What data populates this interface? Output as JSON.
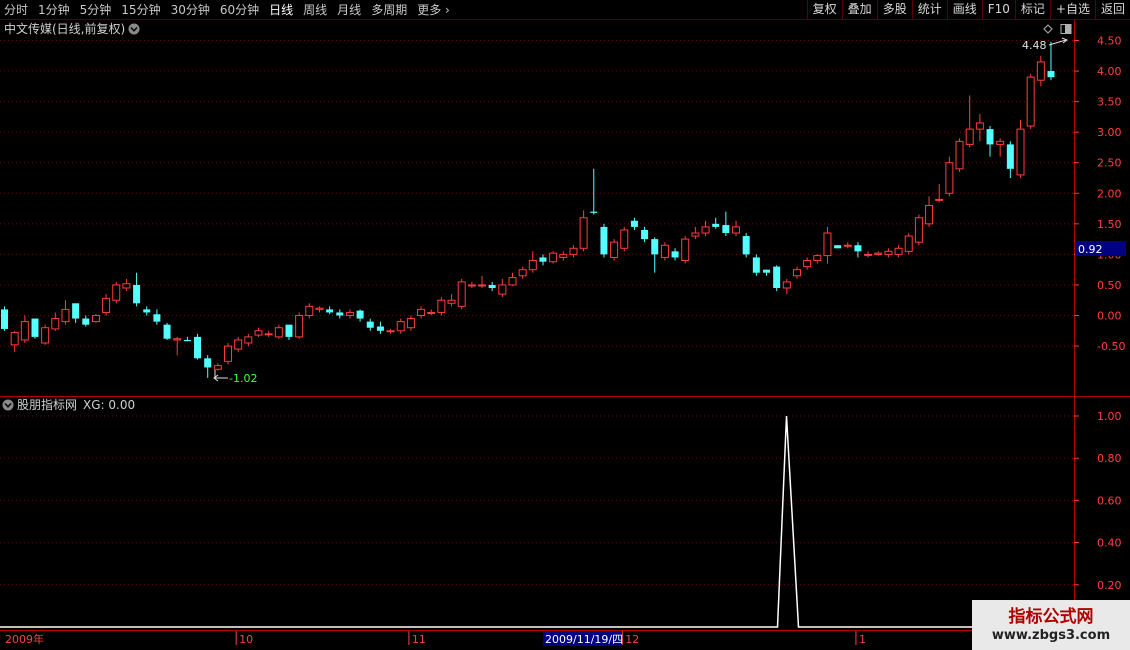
{
  "toolbar": {
    "periods": [
      "分时",
      "1分钟",
      "5分钟",
      "15分钟",
      "30分钟",
      "60分钟",
      "日线",
      "周线",
      "月线",
      "多周期"
    ],
    "active_period": "日线",
    "more": "更多",
    "more_icon": "chevron-right-icon",
    "right_buttons": [
      "复权",
      "叠加",
      "多股",
      "统计",
      "画线",
      "F10",
      "标记",
      "+自选",
      "返回"
    ]
  },
  "main_panel": {
    "title": "中文传媒(日线,前复权)",
    "dropdown_icon": "chevron-down-circle-icon",
    "top_icons": [
      "diamond-icon",
      "window-icon"
    ],
    "current_price_badge": "0.92",
    "high_label": "4.48",
    "low_label": "-1.02"
  },
  "indicator_panel": {
    "title": "股朋指标网",
    "dropdown_icon": "chevron-down-circle-icon",
    "value_label": "XG: 0.00"
  },
  "time_axis": {
    "labels": [
      "2009年",
      "10",
      "11",
      "12",
      "1"
    ],
    "cursor_date": "2009/11/19/四"
  },
  "watermark": {
    "title": "指标公式网",
    "url": "www.zbgs3.com"
  },
  "colors": {
    "up": "#ff3c3c",
    "down": "#54ffff",
    "grid": "#800000",
    "axis_text": "#ff4040",
    "badge_bg": "#000080"
  },
  "chart_data": [
    {
      "type": "candlestick",
      "title": "中文传媒(日线,前复权)",
      "ylim": [
        -1.1,
        4.7
      ],
      "y_ticks": [
        "4.50",
        "4.00",
        "3.50",
        "3.00",
        "2.50",
        "2.00",
        "1.50",
        "1.00",
        "0.50",
        "0.00",
        "-0.50"
      ],
      "y_tick_values": [
        4.5,
        4.0,
        3.5,
        3.0,
        2.5,
        2.0,
        1.5,
        1.0,
        0.5,
        0.0,
        -0.5
      ],
      "x_tick_labels": [
        "2009年",
        "10",
        "11",
        "12",
        "1"
      ],
      "x_tick_index": [
        0,
        23,
        40,
        61,
        84
      ],
      "candles": [
        [
          0.1,
          -0.22,
          0.15,
          -0.25
        ],
        [
          -0.48,
          -0.28,
          -0.25,
          -0.6
        ],
        [
          -0.4,
          -0.1,
          0.0,
          -0.45
        ],
        [
          -0.05,
          -0.35,
          -0.3,
          -0.38
        ],
        [
          -0.45,
          -0.2,
          -0.15,
          -0.48
        ],
        [
          -0.22,
          -0.05,
          0.05,
          -0.25
        ],
        [
          -0.1,
          0.1,
          0.25,
          -0.15
        ],
        [
          0.2,
          -0.05,
          0.15,
          -0.12
        ],
        [
          -0.05,
          -0.15,
          0.0,
          -0.18
        ],
        [
          -0.1,
          0.0,
          0.02,
          -0.12
        ],
        [
          0.05,
          0.28,
          0.35,
          0.0
        ],
        [
          0.25,
          0.5,
          0.55,
          0.2
        ],
        [
          0.45,
          0.52,
          0.6,
          0.4
        ],
        [
          0.5,
          0.2,
          0.7,
          0.15
        ],
        [
          0.1,
          0.05,
          0.15,
          0.0
        ],
        [
          0.02,
          -0.1,
          0.1,
          -0.15
        ],
        [
          -0.15,
          -0.38,
          -0.12,
          -0.4
        ],
        [
          -0.4,
          -0.38,
          -0.35,
          -0.65
        ],
        [
          -0.4,
          -0.42,
          -0.35,
          -0.42
        ],
        [
          -0.35,
          -0.7,
          -0.3,
          -0.72
        ],
        [
          -0.7,
          -0.85,
          -0.65,
          -1.02
        ],
        [
          -0.88,
          -0.82,
          -0.78,
          -0.9
        ],
        [
          -0.75,
          -0.5,
          -0.45,
          -0.8
        ],
        [
          -0.55,
          -0.4,
          -0.35,
          -0.6
        ],
        [
          -0.45,
          -0.35,
          -0.3,
          -0.5
        ],
        [
          -0.32,
          -0.25,
          -0.2,
          -0.35
        ],
        [
          -0.3,
          -0.3,
          -0.25,
          -0.35
        ],
        [
          -0.35,
          -0.2,
          -0.15,
          -0.38
        ],
        [
          -0.15,
          -0.35,
          -0.3,
          -0.4
        ],
        [
          -0.35,
          0.0,
          0.05,
          -0.38
        ],
        [
          0.0,
          0.15,
          0.2,
          -0.05
        ],
        [
          0.1,
          0.12,
          0.15,
          0.05
        ],
        [
          0.1,
          0.05,
          0.15,
          0.02
        ],
        [
          0.05,
          0.0,
          0.1,
          -0.05
        ],
        [
          0.0,
          0.05,
          0.1,
          -0.05
        ],
        [
          0.08,
          -0.05,
          0.1,
          -0.1
        ],
        [
          -0.1,
          -0.2,
          -0.05,
          -0.25
        ],
        [
          -0.18,
          -0.25,
          -0.1,
          -0.3
        ],
        [
          -0.25,
          -0.25,
          -0.22,
          -0.3
        ],
        [
          -0.25,
          -0.1,
          -0.05,
          -0.3
        ],
        [
          -0.2,
          -0.05,
          0.0,
          -0.25
        ],
        [
          0.0,
          0.1,
          0.15,
          -0.05
        ],
        [
          0.05,
          0.05,
          0.1,
          0.0
        ],
        [
          0.05,
          0.25,
          0.3,
          0.0
        ],
        [
          0.2,
          0.25,
          0.35,
          0.15
        ],
        [
          0.15,
          0.55,
          0.6,
          0.1
        ],
        [
          0.5,
          0.5,
          0.55,
          0.45
        ],
        [
          0.5,
          0.5,
          0.65,
          0.45
        ],
        [
          0.5,
          0.45,
          0.55,
          0.4
        ],
        [
          0.35,
          0.5,
          0.6,
          0.3
        ],
        [
          0.5,
          0.62,
          0.7,
          0.48
        ],
        [
          0.65,
          0.75,
          0.8,
          0.6
        ],
        [
          0.75,
          0.9,
          1.05,
          0.7
        ],
        [
          0.95,
          0.88,
          1.0,
          0.82
        ],
        [
          0.88,
          1.02,
          1.05,
          0.85
        ],
        [
          0.95,
          1.0,
          1.05,
          0.9
        ],
        [
          1.0,
          1.1,
          1.15,
          0.95
        ],
        [
          1.1,
          1.6,
          1.72,
          1.05
        ],
        [
          1.7,
          1.68,
          2.4,
          1.65
        ],
        [
          1.45,
          1.0,
          1.5,
          0.95
        ],
        [
          0.95,
          1.2,
          1.25,
          0.9
        ],
        [
          1.1,
          1.4,
          1.45,
          1.05
        ],
        [
          1.55,
          1.45,
          1.6,
          1.4
        ],
        [
          1.4,
          1.25,
          1.45,
          1.2
        ],
        [
          1.25,
          1.0,
          1.28,
          0.7
        ],
        [
          0.95,
          1.15,
          1.2,
          0.9
        ],
        [
          1.05,
          0.95,
          1.1,
          0.9
        ],
        [
          0.9,
          1.25,
          1.3,
          0.85
        ],
        [
          1.3,
          1.35,
          1.45,
          1.25
        ],
        [
          1.35,
          1.45,
          1.55,
          1.3
        ],
        [
          1.5,
          1.45,
          1.6,
          1.42
        ],
        [
          1.48,
          1.35,
          1.7,
          1.3
        ],
        [
          1.35,
          1.45,
          1.55,
          1.3
        ],
        [
          1.3,
          1.0,
          1.35,
          0.95
        ],
        [
          0.95,
          0.7,
          1.0,
          0.65
        ],
        [
          0.75,
          0.7,
          0.75,
          0.65
        ],
        [
          0.8,
          0.45,
          0.82,
          0.4
        ],
        [
          0.45,
          0.55,
          0.6,
          0.35
        ],
        [
          0.65,
          0.75,
          0.8,
          0.6
        ],
        [
          0.8,
          0.9,
          0.95,
          0.75
        ],
        [
          0.9,
          0.98,
          1.0,
          0.85
        ],
        [
          0.98,
          1.35,
          1.45,
          0.85
        ],
        [
          1.15,
          1.1,
          1.15,
          1.1
        ],
        [
          1.15,
          1.15,
          1.2,
          1.1
        ],
        [
          1.15,
          1.05,
          1.2,
          0.95
        ],
        [
          1.0,
          1.0,
          1.05,
          0.95
        ],
        [
          1.0,
          1.02,
          1.05,
          0.98
        ],
        [
          1.0,
          1.05,
          1.1,
          0.95
        ],
        [
          1.0,
          1.1,
          1.15,
          0.95
        ],
        [
          1.05,
          1.3,
          1.35,
          1.0
        ],
        [
          1.2,
          1.6,
          1.65,
          1.15
        ],
        [
          1.5,
          1.8,
          1.95,
          1.45
        ],
        [
          1.9,
          1.9,
          2.15,
          1.85
        ],
        [
          2.0,
          2.5,
          2.6,
          1.95
        ],
        [
          2.4,
          2.85,
          2.9,
          2.35
        ],
        [
          2.8,
          3.05,
          3.6,
          2.75
        ],
        [
          3.05,
          3.15,
          3.3,
          2.85
        ],
        [
          3.05,
          2.8,
          3.1,
          2.6
        ],
        [
          2.8,
          2.85,
          2.9,
          2.6
        ],
        [
          2.8,
          2.4,
          2.85,
          2.25
        ],
        [
          2.3,
          3.05,
          3.2,
          2.25
        ],
        [
          3.1,
          3.9,
          3.95,
          3.05
        ],
        [
          3.85,
          4.15,
          4.25,
          3.75
        ],
        [
          4.0,
          3.9,
          4.48,
          3.85
        ]
      ]
    },
    {
      "type": "line",
      "title": "股朋指标网",
      "series": [
        {
          "name": "XG",
          "values_note": "",
          "values": []
        }
      ],
      "ylim": [
        0,
        1.05
      ],
      "y_ticks": [
        "1.00",
        "0.80",
        "0.60",
        "0.40",
        "0.20"
      ],
      "y_tick_values": [
        1.0,
        0.8,
        0.6,
        0.4,
        0.2
      ],
      "spike_index": 75,
      "spike_value": 1.0,
      "baseline_value": 0.0
    }
  ]
}
